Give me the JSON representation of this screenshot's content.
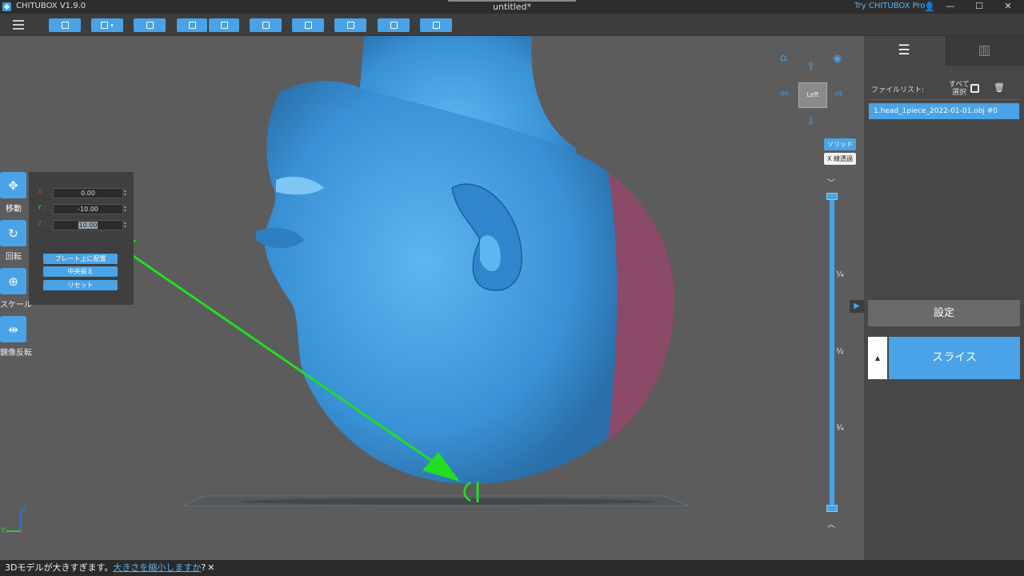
{
  "titlebar": {
    "app_name": "CHITUBOX V1.9.0",
    "document_title": "untitled*",
    "try_pro": "Try CHITUBOX Pro"
  },
  "toolbar": {
    "buttons": [
      "open-file",
      "save",
      "import-model",
      "undo",
      "redo",
      "layout",
      "auto-support",
      "hollow",
      "drill",
      "settings-export"
    ]
  },
  "left_tools": {
    "move_label": "移動",
    "rotate_label": "回転",
    "scale_label": "スケール",
    "mirror_label": "鏡像反転"
  },
  "move_panel": {
    "x_label": "X",
    "y_label": "Y :",
    "z_label": "Z :",
    "x_value": "0.00",
    "y_value": "-10.00",
    "z_value": "10.00",
    "place_on_plate": "プレート上に配置",
    "center": "中央揃え",
    "reset": "リセット",
    "axis_colors": {
      "x": "#d23c3c",
      "y": "#3cc83c",
      "z": "#3a6fd8"
    }
  },
  "view_controls": {
    "cube_face": "Left",
    "solid": "ソリッド",
    "xray": "X 線透過"
  },
  "layer_slider": {
    "tick_quarter": "¼",
    "tick_half": "½",
    "tick_three_quarter": "¾"
  },
  "right_panel": {
    "file_list_label": "ファイルリスト:",
    "select_all": "すべて選択",
    "file_name": "1.head_1piece_2022-01-01.obj #0",
    "settings": "設定",
    "slice": "スライス"
  },
  "statusbar": {
    "message": "3Dモデルが大きすぎます。",
    "link": "大きさを縮小しますか",
    "question": "?",
    "close": "✕"
  },
  "colors": {
    "accent": "#4aa3e6",
    "model": "#3a92d6",
    "annotation": "#22dd22",
    "support_region": "#8a4a68"
  }
}
